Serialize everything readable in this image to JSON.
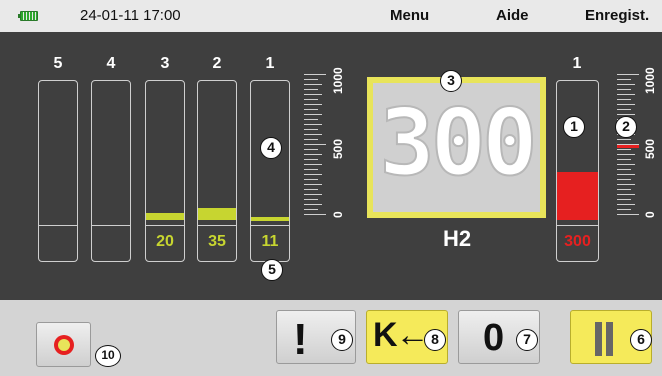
{
  "status_bar": {
    "battery_icon": "battery-icon",
    "datetime": "24-01-11 17:00",
    "menu": [
      "Menu",
      "Aide",
      "Enregist."
    ]
  },
  "columns": {
    "numbers": [
      "5",
      "4",
      "3",
      "2",
      "1"
    ],
    "values": [
      "",
      "",
      "20",
      "35",
      "11"
    ],
    "fill_levels": [
      0,
      0,
      20,
      35,
      11
    ]
  },
  "left_scale": {
    "labels": [
      "1000",
      "500",
      "0"
    ]
  },
  "display": {
    "value": "300",
    "gas": "H2"
  },
  "right_column": {
    "number": "1",
    "value": "300",
    "fill_level": 300
  },
  "right_scale": {
    "labels": [
      "1000",
      "500",
      "0"
    ],
    "marker_value": 500
  },
  "callouts": [
    "1",
    "2",
    "3",
    "4",
    "5",
    "6",
    "7",
    "8",
    "9",
    "10"
  ],
  "buttons": {
    "record_icon": "record-icon",
    "alert_label": "!",
    "rewind_label": "K←",
    "zero_label": "0",
    "pause_icon": "pause-icon"
  },
  "colors": {
    "accent_yellow": "#c7d530",
    "highlight_yellow": "#f5ea5a",
    "alarm_red": "#e62020"
  }
}
